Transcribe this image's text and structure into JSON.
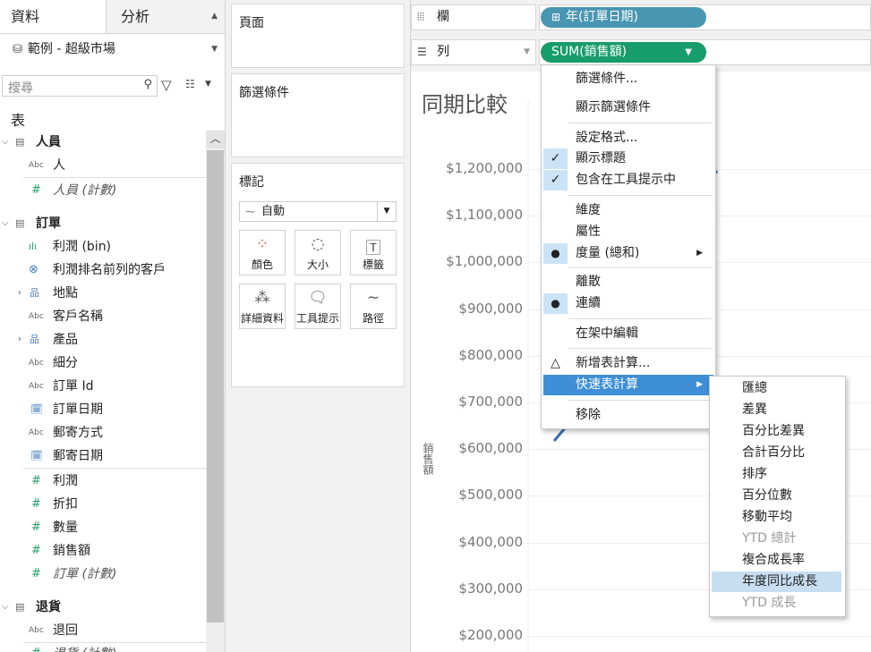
{
  "tabs": {
    "data": "資料",
    "analytics": "分析"
  },
  "datasource": "範例 - 超級市場",
  "search": {
    "placeholder": "搜尋"
  },
  "tables_label": "表",
  "tree": {
    "people": {
      "label": "人員",
      "fields": [
        "人",
        "人員 (計數)"
      ]
    },
    "orders": {
      "label": "訂單",
      "dims": [
        "利潤 (bin)",
        "利潤排名前列的客戶",
        "地點",
        "客戶名稱",
        "產品",
        "細分",
        "訂單 Id",
        "訂單日期",
        "郵寄方式",
        "郵寄日期"
      ],
      "measures": [
        "利潤",
        "折扣",
        "數量",
        "銷售額",
        "訂單 (計數)"
      ]
    },
    "returns": {
      "label": "退貨",
      "fields": [
        "退回",
        "退貨 (計數)"
      ]
    }
  },
  "cards": {
    "pages": "頁面",
    "filters": "篩選條件",
    "marks": "標記",
    "mark_type": "自動",
    "mark_buttons": [
      "顏色",
      "大小",
      "標籤",
      "詳細資料",
      "工具提示",
      "路徑"
    ]
  },
  "shelves": {
    "columns_label": "欄",
    "rows_label": "列",
    "columns_pill": "年(訂單日期)",
    "rows_pill": "SUM(銷售額)"
  },
  "chart": {
    "title": "同期比較",
    "ylabel": "銷售額",
    "ticks": [
      "$1,200,000",
      "$1,100,000",
      "$1,000,000",
      "$900,000",
      "$800,000",
      "$700,000",
      "$600,000",
      "$500,000",
      "$400,000",
      "$300,000",
      "$200,000"
    ]
  },
  "menu": {
    "items": [
      "篩選條件...",
      "顯示篩選條件",
      "設定格式...",
      "顯示標題",
      "包含在工具提示中",
      "維度",
      "屬性",
      "度量 (總和)",
      "離散",
      "連續",
      "在架中編輯",
      "新增表計算...",
      "快速表計算",
      "移除"
    ]
  },
  "submenu": {
    "items": [
      "匯總",
      "差異",
      "百分比差異",
      "合計百分比",
      "排序",
      "百分位數",
      "移動平均",
      "YTD 總計",
      "複合成長率",
      "年度同比成長",
      "YTD 成長"
    ]
  },
  "colors": {
    "year_pill": "#4996b2",
    "sales_pill": "#179c6b",
    "highlight": "#3f8fd6",
    "line": "#3a6fb0"
  }
}
